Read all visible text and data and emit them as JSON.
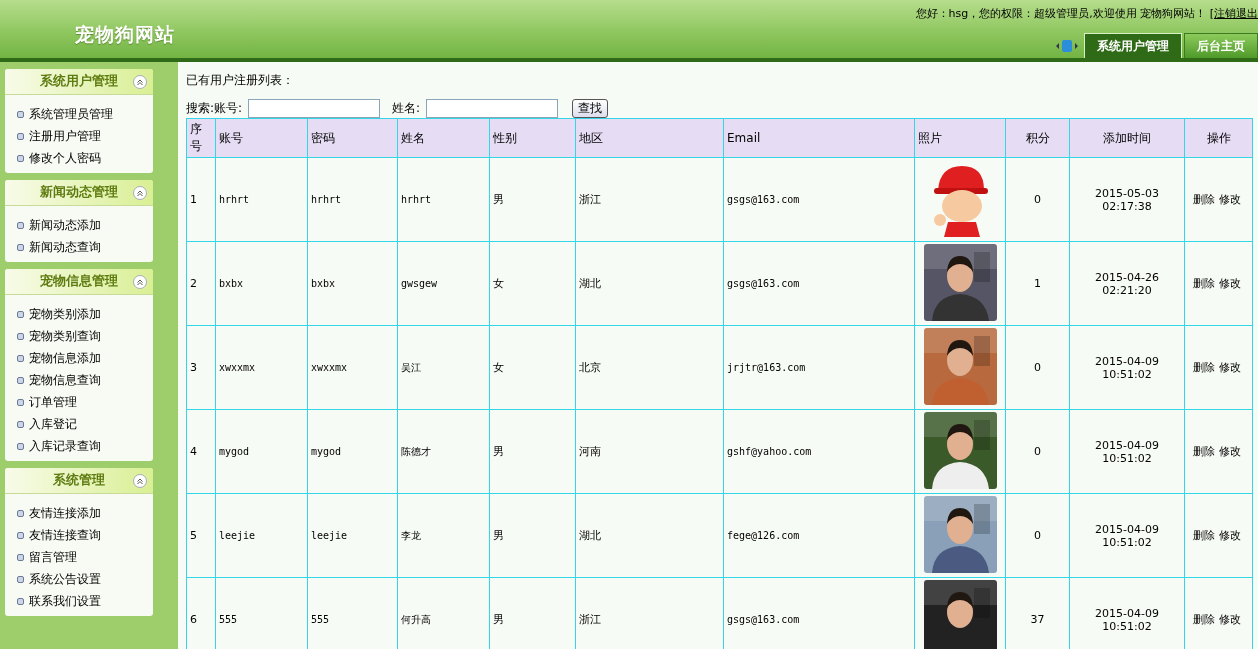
{
  "header": {
    "site_title": "宠物狗网站",
    "greeting": "您好：hsg，您的权限：超级管理员,欢迎使用 宠物狗网站！ [",
    "logout_link": "注销退出",
    "tabs": [
      {
        "label": "系统用户管理",
        "selected": true
      },
      {
        "label": "后台主页",
        "selected": false
      }
    ]
  },
  "sidebar": [
    {
      "title": "系统用户管理",
      "expanded": true,
      "items": [
        "系统管理员管理",
        "注册用户管理",
        "修改个人密码"
      ]
    },
    {
      "title": "新闻动态管理",
      "expanded": true,
      "items": [
        "新闻动态添加",
        "新闻动态查询"
      ]
    },
    {
      "title": "宠物信息管理",
      "expanded": true,
      "items": [
        "宠物类别添加",
        "宠物类别查询",
        "宠物信息添加",
        "宠物信息查询",
        "订单管理",
        "入库登记",
        "入库记录查询"
      ]
    },
    {
      "title": "系统管理",
      "expanded": true,
      "items": [
        "友情连接添加",
        "友情连接查询",
        "留言管理",
        "系统公告设置",
        "联系我们设置"
      ]
    }
  ],
  "content": {
    "heading": "已有用户注册列表：",
    "search_label": "搜索:账号:",
    "name_label": "姓名:",
    "search_button": "查找",
    "table": {
      "columns": [
        "序号",
        "账号",
        "密码",
        "姓名",
        "性别",
        "地区",
        "Email",
        "照片",
        "积分",
        "添加时间",
        "操作"
      ],
      "rows": [
        {
          "no": "1",
          "account": "hrhrt",
          "password": "hrhrt",
          "name": "hrhrt",
          "gender": "男",
          "region": "浙江",
          "email": "gsgs@163.com",
          "photo": {
            "kind": "cartoon"
          },
          "points": "0",
          "date": "2015-05-03",
          "time": "02:17:38",
          "delete": "删除",
          "edit": "修改"
        },
        {
          "no": "2",
          "account": "bxbx",
          "password": "bxbx",
          "name": "gwsgew",
          "gender": "女",
          "region": "湖北",
          "email": "gsgs@163.com",
          "points": "1",
          "date": "2015-04-26",
          "time": "02:21:20",
          "delete": "删除",
          "edit": "修改"
        },
        {
          "no": "3",
          "account": "xwxxmx",
          "password": "xwxxmx",
          "name": "吴江",
          "gender": "女",
          "region": "北京",
          "email": "jrjtr@163.com",
          "points": "0",
          "date": "2015-04-09",
          "time": "10:51:02",
          "delete": "删除",
          "edit": "修改"
        },
        {
          "no": "4",
          "account": "mygod",
          "password": "mygod",
          "name": "陈德才",
          "gender": "男",
          "region": "河南",
          "email": "gshf@yahoo.com",
          "points": "0",
          "date": "2015-04-09",
          "time": "10:51:02",
          "delete": "删除",
          "edit": "修改"
        },
        {
          "no": "5",
          "account": "leejie",
          "password": "leejie",
          "name": "李龙",
          "gender": "男",
          "region": "湖北",
          "email": "fege@126.com",
          "points": "0",
          "date": "2015-04-09",
          "time": "10:51:02",
          "delete": "删除",
          "edit": "修改"
        },
        {
          "no": "6",
          "account": "555",
          "password": "555",
          "name": "何升高",
          "gender": "男",
          "region": "浙江",
          "email": "gsgs@163.com",
          "points": "37",
          "date": "2015-04-09",
          "time": "10:51:02",
          "delete": "删除",
          "edit": "修改"
        }
      ]
    }
  }
}
